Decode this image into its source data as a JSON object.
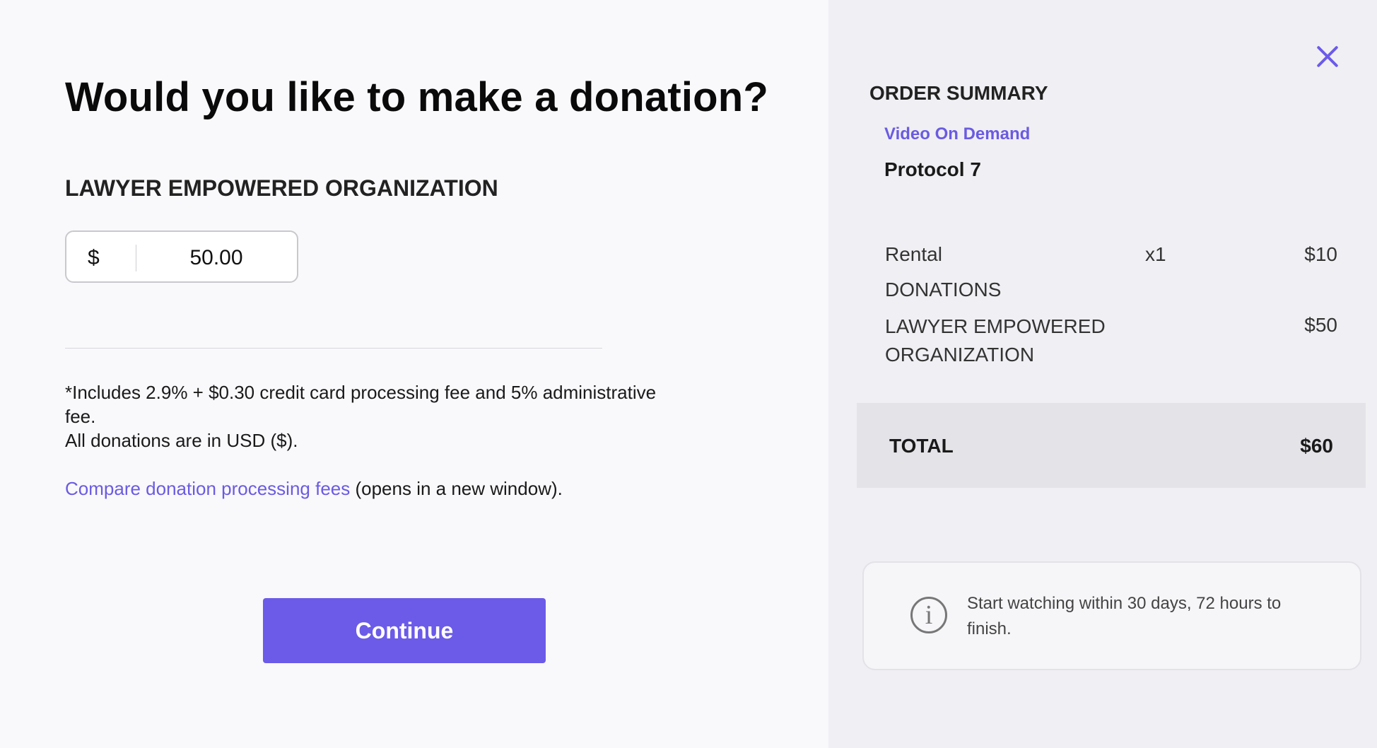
{
  "donation": {
    "title": "Would you like to make a donation?",
    "organization": "LAWYER EMPOWERED ORGANIZATION",
    "currency_symbol": "$",
    "amount": "50.00",
    "fee_note": "*Includes 2.9% + $0.30 credit card processing fee and 5% administrative fee.",
    "currency_note": "All donations are in USD ($).",
    "compare_link": "Compare donation processing fees",
    "compare_suffix": " (opens in a new window).",
    "continue_label": "Continue"
  },
  "summary": {
    "close_icon": "close-icon",
    "title": "ORDER SUMMARY",
    "category": "Video On Demand",
    "film": "Protocol 7",
    "rental": {
      "label": "Rental",
      "qty": "x1",
      "price": "$10"
    },
    "donations_heading": "DONATIONS",
    "donation_line": {
      "label": "LAWYER EMPOWERED ORGANIZATION",
      "price": "$50"
    },
    "total_label": "TOTAL",
    "total_value": "$60",
    "info_icon": "info-icon",
    "info_text": "Start watching within 30 days, 72 hours to finish."
  },
  "colors": {
    "accent": "#6b5be8",
    "left_background": "#f9f8fb",
    "right_background": "#f0eff3",
    "total_background": "#e4e3e8"
  }
}
